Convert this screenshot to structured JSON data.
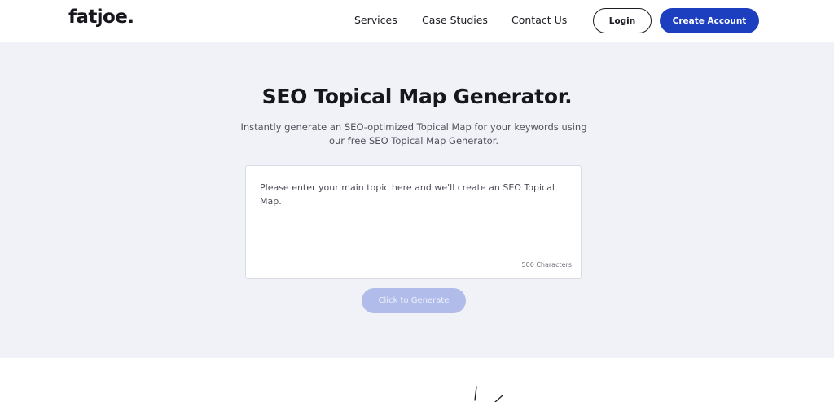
{
  "header": {
    "logo": "fatjoe.",
    "nav": {
      "services": "Services",
      "case_studies": "Case Studies",
      "contact_us": "Contact Us"
    },
    "login_label": "Login",
    "create_account_label": "Create Account"
  },
  "hero": {
    "title": "SEO Topical Map Generator.",
    "subtitle": "Instantly generate an SEO-optimized Topical Map for your keywords using our free SEO Topical Map Generator.",
    "topic_input": {
      "value": "",
      "placeholder": "Please enter your main topic here and we'll create an SEO Topical Map."
    },
    "char_limit": "500 Characters",
    "generate_label": "Click to Generate"
  },
  "colors": {
    "brand_blue": "#1c3fbf",
    "generate_disabled": "#b1bcea",
    "hero_background": "#f0f2f7"
  }
}
